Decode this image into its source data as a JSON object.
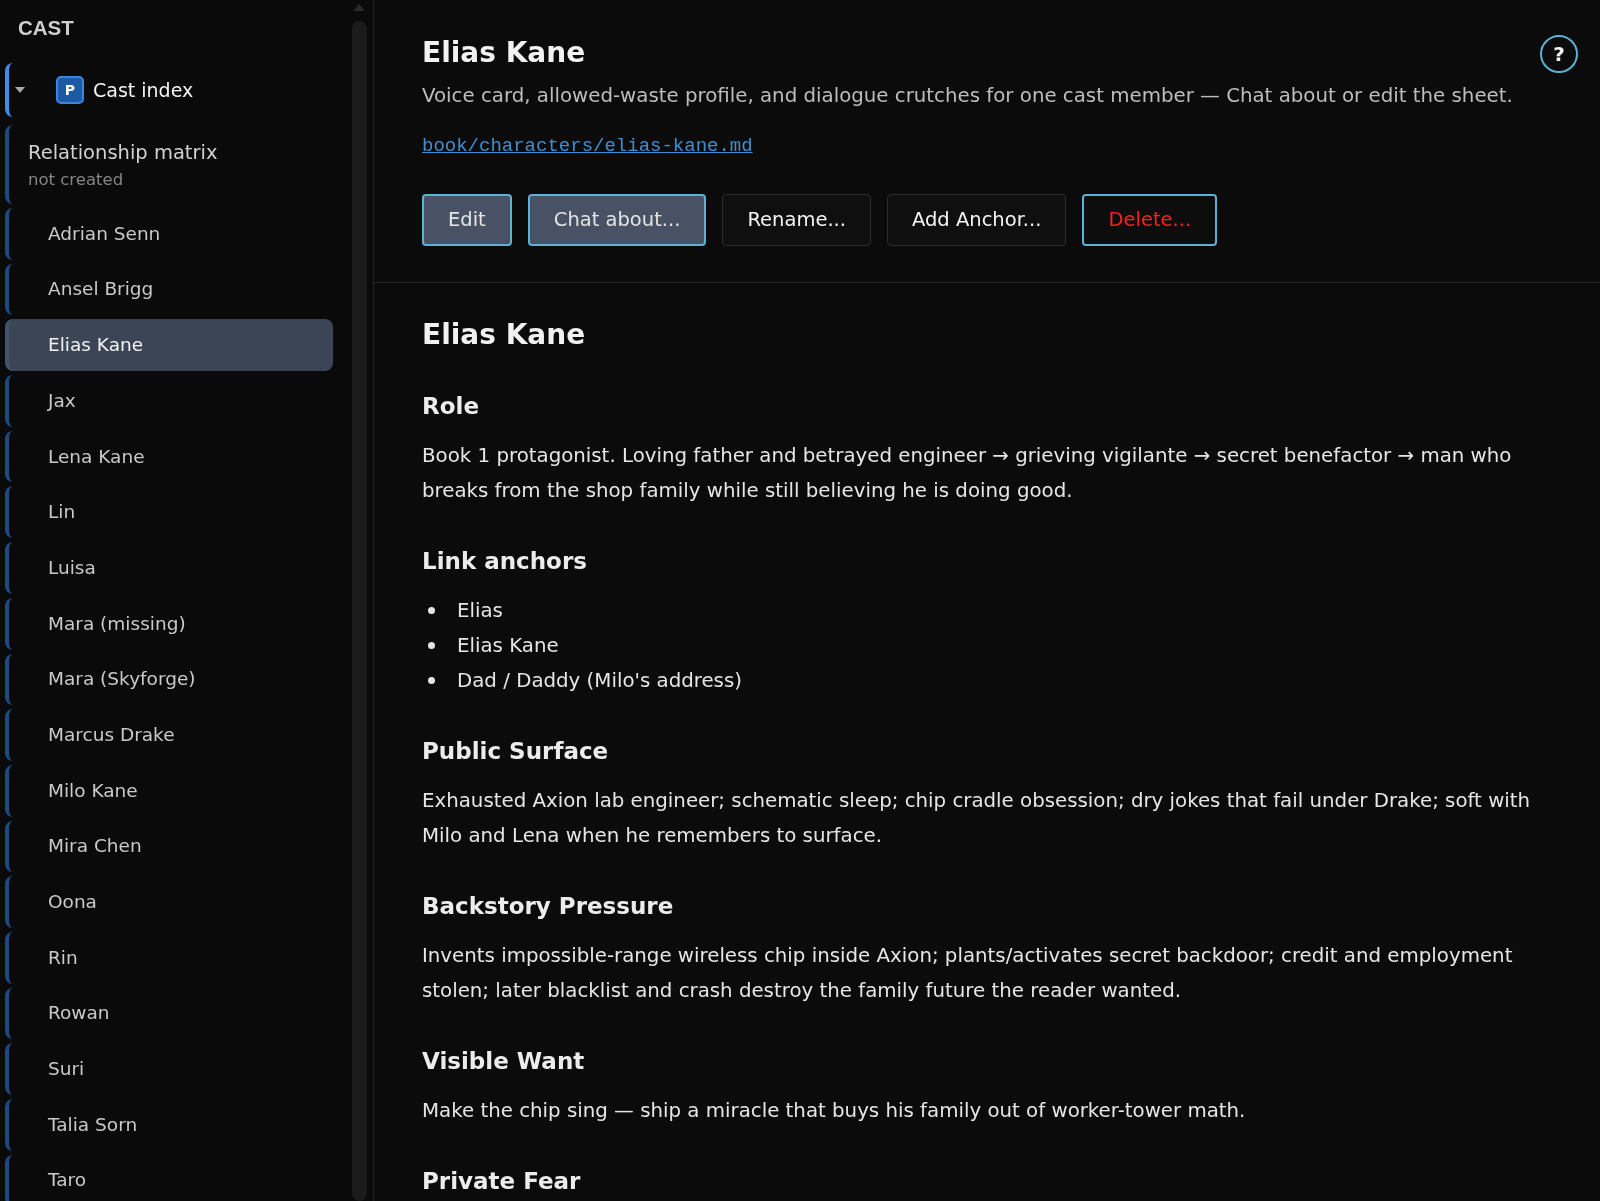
{
  "sidebar": {
    "heading": "CAST",
    "items": [
      {
        "kind": "index",
        "label": "Cast index",
        "badge": "P",
        "expanded": true,
        "selected": false
      },
      {
        "kind": "document",
        "label": "Relationship matrix",
        "note": "not created",
        "selected": false
      },
      {
        "kind": "character",
        "label": "Adrian Senn",
        "selected": false
      },
      {
        "kind": "character",
        "label": "Ansel Brigg",
        "selected": false
      },
      {
        "kind": "character",
        "label": "Elias Kane",
        "selected": true
      },
      {
        "kind": "character",
        "label": "Jax",
        "selected": false
      },
      {
        "kind": "character",
        "label": "Lena Kane",
        "selected": false
      },
      {
        "kind": "character",
        "label": "Lin",
        "selected": false
      },
      {
        "kind": "character",
        "label": "Luisa",
        "selected": false
      },
      {
        "kind": "character",
        "label": "Mara (missing)",
        "selected": false
      },
      {
        "kind": "character",
        "label": "Mara (Skyforge)",
        "selected": false
      },
      {
        "kind": "character",
        "label": "Marcus Drake",
        "selected": false
      },
      {
        "kind": "character",
        "label": "Milo Kane",
        "selected": false
      },
      {
        "kind": "character",
        "label": "Mira Chen",
        "selected": false
      },
      {
        "kind": "character",
        "label": "Oona",
        "selected": false
      },
      {
        "kind": "character",
        "label": "Rin",
        "selected": false
      },
      {
        "kind": "character",
        "label": "Rowan",
        "selected": false
      },
      {
        "kind": "character",
        "label": "Suri",
        "selected": false
      },
      {
        "kind": "character",
        "label": "Talia Sorn",
        "selected": false
      },
      {
        "kind": "character",
        "label": "Taro",
        "selected": false
      }
    ]
  },
  "header": {
    "title": "Elias Kane",
    "description": "Voice card, allowed-waste profile, and dialogue crutches for one cast member — Chat about or edit the sheet.",
    "path": "book/characters/elias-kane.md",
    "help": "?",
    "buttons": [
      {
        "label": "Edit",
        "kind": "filled"
      },
      {
        "label": "Chat about...",
        "kind": "filled"
      },
      {
        "label": "Rename...",
        "kind": "plain"
      },
      {
        "label": "Add Anchor...",
        "kind": "plain"
      },
      {
        "label": "Delete...",
        "kind": "danger"
      }
    ]
  },
  "document": {
    "title": "Elias Kane",
    "sections": [
      {
        "heading": "Role",
        "kind": "paragraph",
        "text": "Book 1 protagonist. Loving father and betrayed engineer → grieving vigilante → secret benefactor → man who breaks from the shop family while still believing he is doing good."
      },
      {
        "heading": "Link anchors",
        "kind": "list",
        "items": [
          "Elias",
          "Elias Kane",
          "Dad / Daddy (Milo's address)"
        ]
      },
      {
        "heading": "Public Surface",
        "kind": "paragraph",
        "text": "Exhausted Axion lab engineer; schematic sleep; chip cradle obsession; dry jokes that fail under Drake; soft with Milo and Lena when he remembers to surface."
      },
      {
        "heading": "Backstory Pressure",
        "kind": "paragraph",
        "text": "Invents impossible-range wireless chip inside Axion; plants/activates secret backdoor; credit and employment stolen; later blacklist and crash destroy the family future the reader wanted."
      },
      {
        "heading": "Visible Want",
        "kind": "paragraph",
        "text": "Make the chip sing — ship a miracle that buys his family out of worker-tower math."
      },
      {
        "heading": "Private Fear",
        "kind": "heading"
      }
    ]
  }
}
